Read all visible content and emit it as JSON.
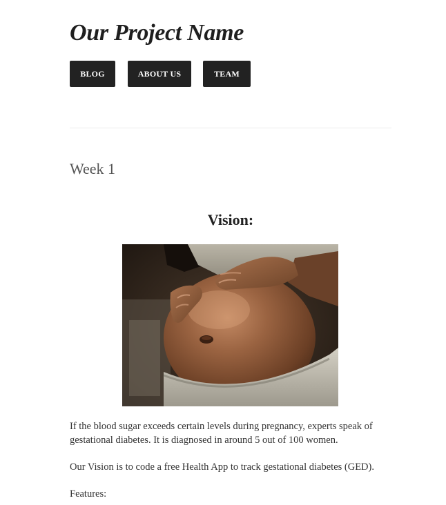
{
  "header": {
    "site_title": "Our Project Name",
    "nav": [
      {
        "label": "BLOG"
      },
      {
        "label": "ABOUT US"
      },
      {
        "label": "TEAM"
      }
    ]
  },
  "post": {
    "title": "Week 1",
    "section_heading": "Vision:",
    "image_subject": "pregnant-belly-photo",
    "paragraphs": [
      "If the blood sugar exceeds certain levels during pregnancy, experts speak of gestational diabetes. It is diagnosed in around 5 out of 100 women.",
      "Our Vision is to code a free Health App to track gestational diabetes (GED).",
      "Features:"
    ]
  },
  "colors": {
    "nav_button_bg": "#222222",
    "nav_button_text": "#ffffff",
    "title_text": "#1f1f1f",
    "body_text": "#333333",
    "muted_heading": "#555555",
    "divider": "#ececec"
  }
}
